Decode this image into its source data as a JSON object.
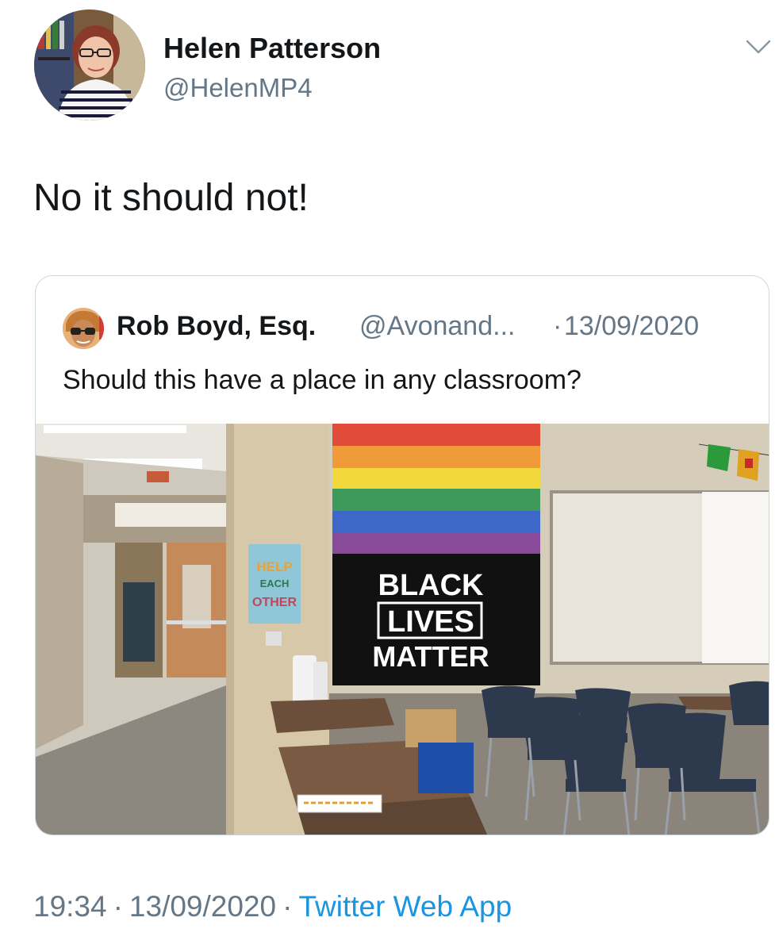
{
  "author": {
    "name": "Helen Patterson",
    "handle": "@HelenMP4",
    "avatar_icon": "profile-photo-woman-glasses"
  },
  "tweet": {
    "text": "No it should not!"
  },
  "quoted_tweet": {
    "name": "Rob Boyd, Esq.",
    "handle": "@Avonand...",
    "separator": "·",
    "date": "13/09/2020",
    "text": "Should this have a place in any classroom?",
    "avatar_icon": "cartoon-avatar-sunglasses",
    "photo": {
      "description_icon": "classroom-photo",
      "flag_text_line1": "BLACK",
      "flag_text_line2": "LIVES",
      "flag_text_line3": "MATTER",
      "poster_line1": "HELP",
      "poster_line2": "EACH",
      "poster_line3": "OTHER"
    }
  },
  "footer": {
    "time": "19:34",
    "separator": "·",
    "date": "13/09/2020",
    "source": "Twitter Web App"
  },
  "colors": {
    "text_primary": "#14171a",
    "text_secondary": "#657786",
    "link": "#1b95e0",
    "border": "#ccd6dd"
  }
}
